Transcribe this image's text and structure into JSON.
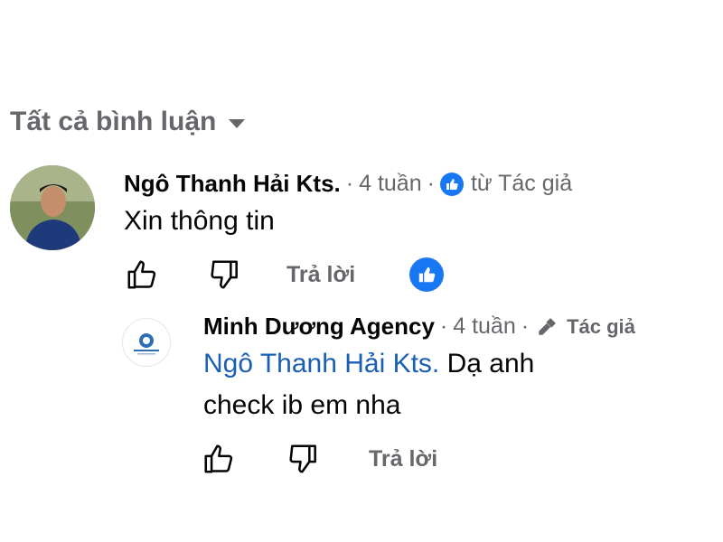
{
  "header": {
    "filter_label": "Tất cả bình luận"
  },
  "comments": [
    {
      "author": "Ngô Thanh Hải Kts.",
      "time": "4 tuần",
      "badge": "từ Tác giả",
      "text": "Xin thông tin",
      "reply_label": "Trả lời"
    }
  ],
  "replies": [
    {
      "author": "Minh Dương Agency",
      "time": "4 tuần",
      "badge": "Tác giả",
      "mention": "Ngô Thanh Hải Kts.",
      "text_line1": "Dạ anh",
      "text_line2": "check ib em nha",
      "reply_label": "Trả lời"
    }
  ],
  "colors": {
    "brand_blue": "#1877f2",
    "mention": "#1a5fb4",
    "muted": "#65676b"
  }
}
